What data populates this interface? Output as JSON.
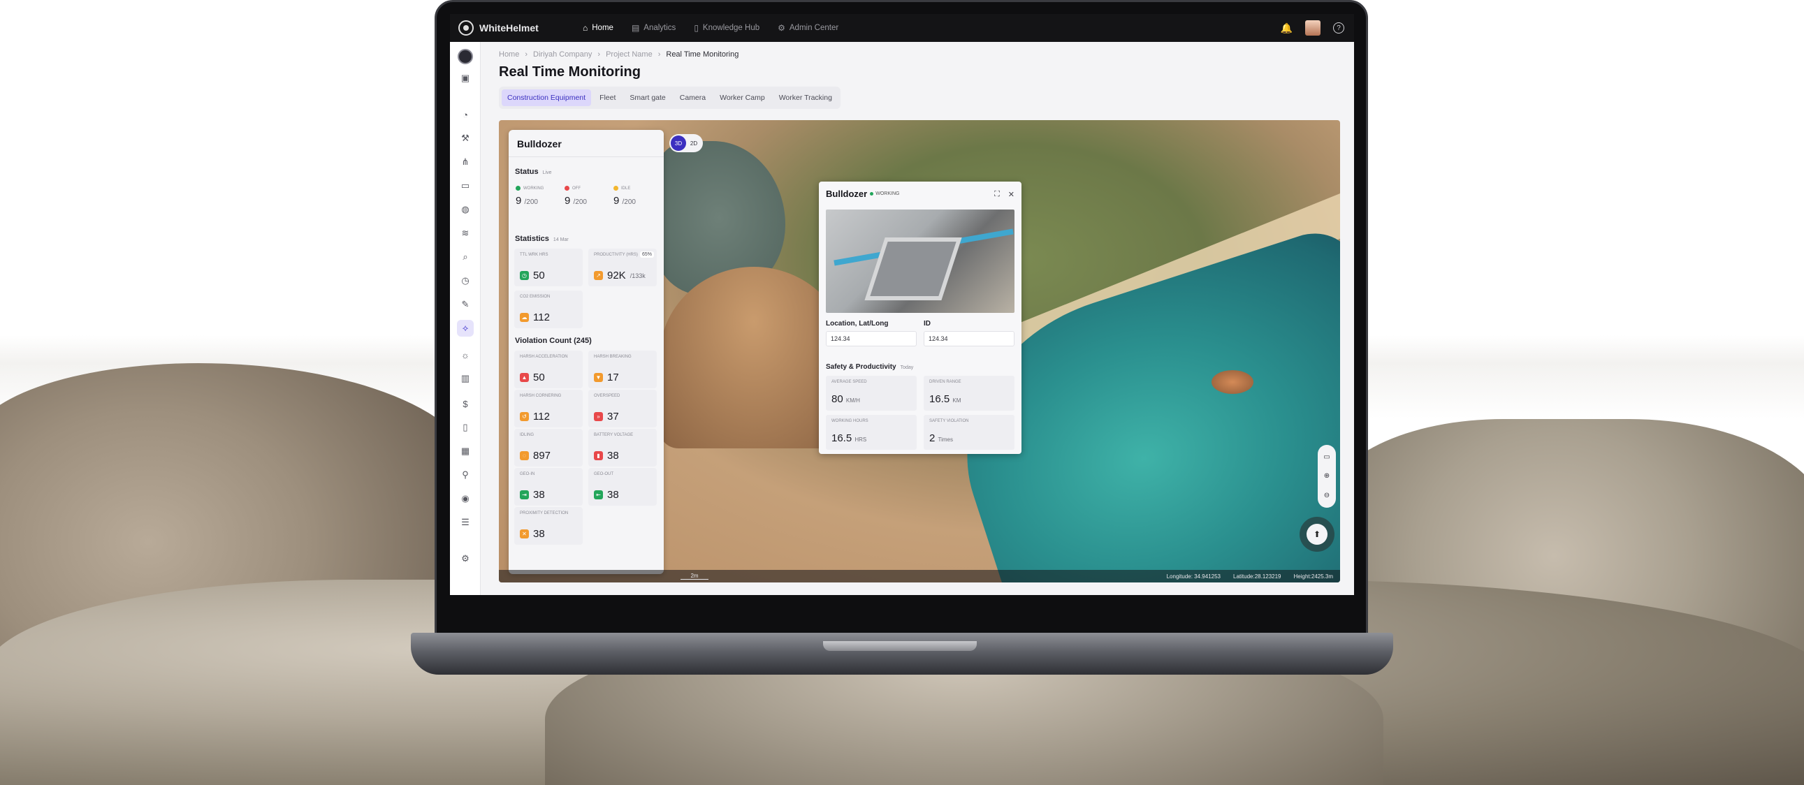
{
  "topbar": {
    "brand": "WhiteHelmet",
    "nav": [
      {
        "label": "Home",
        "icon": "home-icon",
        "active": true
      },
      {
        "label": "Analytics",
        "icon": "analytics-icon"
      },
      {
        "label": "Knowledge Hub",
        "icon": "book-icon"
      },
      {
        "label": "Admin Center",
        "icon": "gear-icon"
      }
    ]
  },
  "breadcrumb": [
    "Home",
    "Diriyah Company",
    "Project Name",
    "Real Time Monitoring"
  ],
  "page_title": "Real Time Monitoring",
  "tabs": [
    "Construction Equipment",
    "Fleet",
    "Smart gate",
    "Camera",
    "Worker Camp",
    "Worker Tracking"
  ],
  "panel": {
    "title": "Bulldozer",
    "status": {
      "title": "Status",
      "sub": "Live",
      "items": [
        {
          "label": "WORKING",
          "value": "9",
          "of": "/200",
          "color": "#22a55a"
        },
        {
          "label": "OFF",
          "value": "9",
          "of": "/200",
          "color": "#e8484a"
        },
        {
          "label": "IDLE",
          "value": "9",
          "of": "/200",
          "color": "#f2b62e"
        }
      ]
    },
    "statistics": {
      "title": "Statistics",
      "sub": "14 Mar",
      "items": [
        {
          "label": "TTL WRK HRS",
          "value": "50"
        },
        {
          "label": "PRODUCTIVITY (HRS)",
          "value": "92K",
          "of": "/133k",
          "badge": "65%"
        },
        {
          "label": "CO2 EMISSION",
          "value": "112"
        }
      ]
    },
    "violations": {
      "title": "Violation Count (245)",
      "items": [
        {
          "label": "HARSH ACCELERATION",
          "value": "50"
        },
        {
          "label": "HARSH BREAKING",
          "value": "17"
        },
        {
          "label": "HARSH CORNERING",
          "value": "112"
        },
        {
          "label": "OVERSPEED",
          "value": "37"
        },
        {
          "label": "IDLING",
          "value": "897"
        },
        {
          "label": "BATTERY VOLTAGE",
          "value": "38"
        },
        {
          "label": "GEO-IN",
          "value": "38"
        },
        {
          "label": "GEO-OUT",
          "value": "38"
        },
        {
          "label": "PROXIMITY DETECTION",
          "value": "38"
        }
      ]
    }
  },
  "view_toggle": [
    "3D",
    "2D"
  ],
  "popup": {
    "title": "Bulldozer",
    "status": "WORKING",
    "location_label": "Location, Lat/Long",
    "location_value": "124.34",
    "id_label": "ID",
    "id_value": "124.34",
    "safety_title": "Safety & Productivity",
    "safety_sub": "Today",
    "metrics": [
      {
        "label": "AVERAGE SPEED",
        "value": "80",
        "unit": "KM/H"
      },
      {
        "label": "DRIVEN RANGE",
        "value": "16.5",
        "unit": "KM"
      },
      {
        "label": "WORKING HOURS",
        "value": "16.5",
        "unit": "HRS"
      },
      {
        "label": "SAFETY VIOLATION",
        "value": "2",
        "unit": "Times"
      }
    ]
  },
  "map_footer": {
    "scale": "2m",
    "longitude": "Longitude: 34.941253",
    "latitude": "Latitude:28.123219",
    "height": "Height:2425.3m"
  }
}
